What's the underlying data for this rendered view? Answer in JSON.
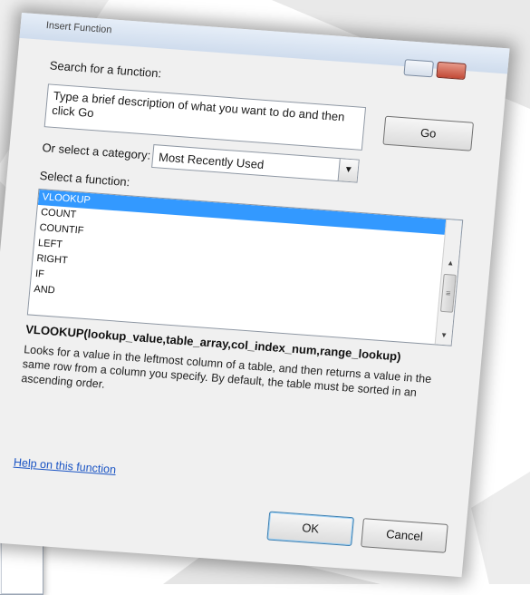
{
  "dialog": {
    "title": "Insert Function",
    "search_label": "Search for a function:",
    "search_placeholder": "Type a brief description of what you want to do and then click Go",
    "go_label": "Go",
    "category_label": "Or select a category:",
    "category_value": "Most Recently Used",
    "select_function_label": "Select a function:",
    "functions": [
      "VLOOKUP",
      "COUNT",
      "COUNTIF",
      "LEFT",
      "RIGHT",
      "IF",
      "AND"
    ],
    "selected_function": "VLOOKUP",
    "signature": "VLOOKUP(lookup_value,table_array,col_index_num,range_lookup)",
    "description": "Looks for a value in the leftmost column of a table, and then returns a value in the same row from a column you specify. By default, the table must be sorted in an ascending order.",
    "help_link": "Help on this function",
    "ok_label": "OK",
    "cancel_label": "Cancel"
  },
  "secondary_window": {
    "close_label": "x"
  },
  "colors": {
    "selection": "#3399ff",
    "link": "#1a54c4",
    "close_button": "#c24a37"
  }
}
